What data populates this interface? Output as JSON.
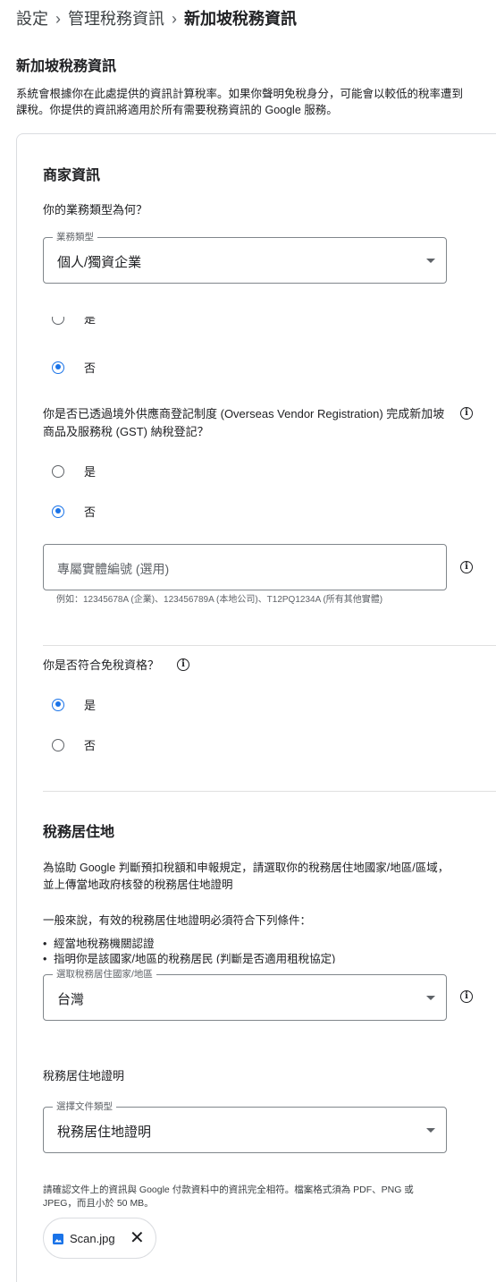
{
  "breadcrumb": {
    "items": [
      "設定",
      "管理稅務資訊",
      "新加坡稅務資訊"
    ],
    "separator": "›"
  },
  "page_title": "新加坡稅務資訊",
  "intro": "系統會根據你在此處提供的資訊計算稅率。如果你聲明免稅身分，可能會以較低的稅率遭到課稅。你提供的資訊將適用於所有需要稅務資訊的 Google 服務。",
  "business": {
    "section_title": "商家資訊",
    "question_type": "你的業務類型為何？",
    "type_select": {
      "label": "業務類型",
      "value": "個人/獨資企業"
    },
    "partial_option": "是",
    "option_no_1": "否",
    "question_ovr": "你是否已透過境外供應商登記制度 (Overseas Vendor Registration) 完成新加坡商品及服務稅 (GST) 納稅登記？",
    "option_yes_2": "是",
    "option_no_2": "否",
    "uen_field": {
      "placeholder": "專屬實體編號 (選用)"
    },
    "uen_helper": "例如：12345678A (企業)、123456789A (本地公司)、T12PQ1234A (所有其他實體)",
    "question_exempt": "你是否符合免稅資格？",
    "option_yes_3": "是",
    "option_no_3": "否"
  },
  "residence": {
    "section_title": "稅務居住地",
    "description": "為協助 Google 判斷預扣稅額和申報規定，請選取你的稅務居住地國家/地區/區域，並上傳當地政府核發的稅務居住地證明",
    "requirements_intro": "一般來說，有效的稅務居住地證明必須符合下列條件：",
    "requirements": [
      "經當地稅務機關認證",
      "指明你是該國家/地區的稅務居民 (判斷是否適用租稅協定)"
    ],
    "country_select": {
      "label": "選取稅務居住國家/地區",
      "value": "台灣"
    },
    "proof_title": "稅務居住地證明",
    "doc_select": {
      "label": "選擇文件類型",
      "value": "稅務居住地證明"
    },
    "note": "請確認文件上的資訊與 Google 付款資料中的資訊完全相符。檔案格式須為 PDF、PNG 或 JPEG，而且小於 50 MB。",
    "file_chip": {
      "name": "Scan.jpg",
      "remove": "✕"
    }
  },
  "colors": {
    "accent": "#1a73e8",
    "border": "#80868b",
    "text": "#202124"
  },
  "icons": {
    "info": "info-icon",
    "dropdown": "caret-down-icon",
    "image_file": "image-file-icon",
    "remove": "close-icon"
  }
}
